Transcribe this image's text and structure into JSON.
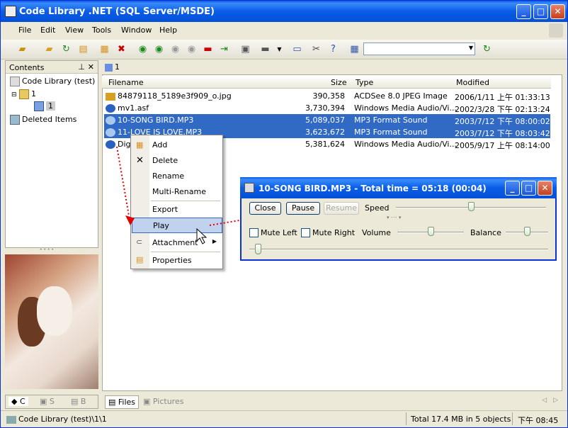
{
  "window": {
    "title": "Code Library .NET (SQL Server/MSDE)"
  },
  "menu": [
    "File",
    "Edit",
    "View",
    "Tools",
    "Window",
    "Help"
  ],
  "contents": {
    "title": "Contents",
    "root": "Code Library (test)",
    "node1": "1",
    "node2": "1",
    "deleted": "Deleted Items"
  },
  "tab": {
    "label": "1"
  },
  "table": {
    "headers": [
      "Filename",
      "Size",
      "Type",
      "Modified"
    ],
    "rows": [
      {
        "name": "84879118_5189e3f909_o.jpg",
        "size": "390,358",
        "type": "ACDSee 8.0 JPEG Image",
        "modified": "2006/1/11 上午 01:33:13",
        "selected": false
      },
      {
        "name": "mv1.asf",
        "size": "3,730,394",
        "type": "Windows Media Audio/Vi...",
        "modified": "2002/3/28 下午 02:13:24",
        "selected": false
      },
      {
        "name": "10-SONG BIRD.MP3",
        "size": "5,089,037",
        "type": "MP3 Format Sound",
        "modified": "2003/7/12 下午 08:00:02",
        "selected": true
      },
      {
        "name": "11-LOVE IS LOVE.MP3",
        "size": "3,623,672",
        "type": "MP3 Format Sound",
        "modified": "2003/7/12 下午 08:03:42",
        "selected": true
      },
      {
        "name": "Digi",
        "size": "5,381,624",
        "type": "Windows Media Audio/Vi...",
        "modified": "2005/9/17 上午 08:14:00",
        "selected": false
      }
    ]
  },
  "context_menu": {
    "items": [
      "Add",
      "Delete",
      "Rename",
      "Multi-Rename",
      "Export",
      "Play",
      "Attachment",
      "Properties"
    ],
    "highlighted": "Play"
  },
  "player": {
    "title": "10-SONG BIRD.MP3 - Total time = 05:18 (00:04)",
    "close": "Close",
    "pause": "Pause",
    "resume": "Resume",
    "speed": "Speed",
    "mute_left": "Mute Left",
    "mute_right": "Mute Right",
    "volume": "Volume",
    "balance": "Balance",
    "speed_level": 0.5,
    "volume_level": 0.5,
    "balance_level": 0.5,
    "progress_level": 0.02
  },
  "left_tabs": [
    "C",
    "S",
    "B"
  ],
  "bottom_tabs": [
    "Files",
    "Pictures"
  ],
  "status": {
    "path": "Code Library (test)\\1\\1",
    "total": "Total 17.4 MB in 5 objects",
    "time": "下午 08:45"
  },
  "colors": {
    "title_blue": "#0a5de8",
    "selection": "#316ac5",
    "arrow_red": "#e00000"
  }
}
